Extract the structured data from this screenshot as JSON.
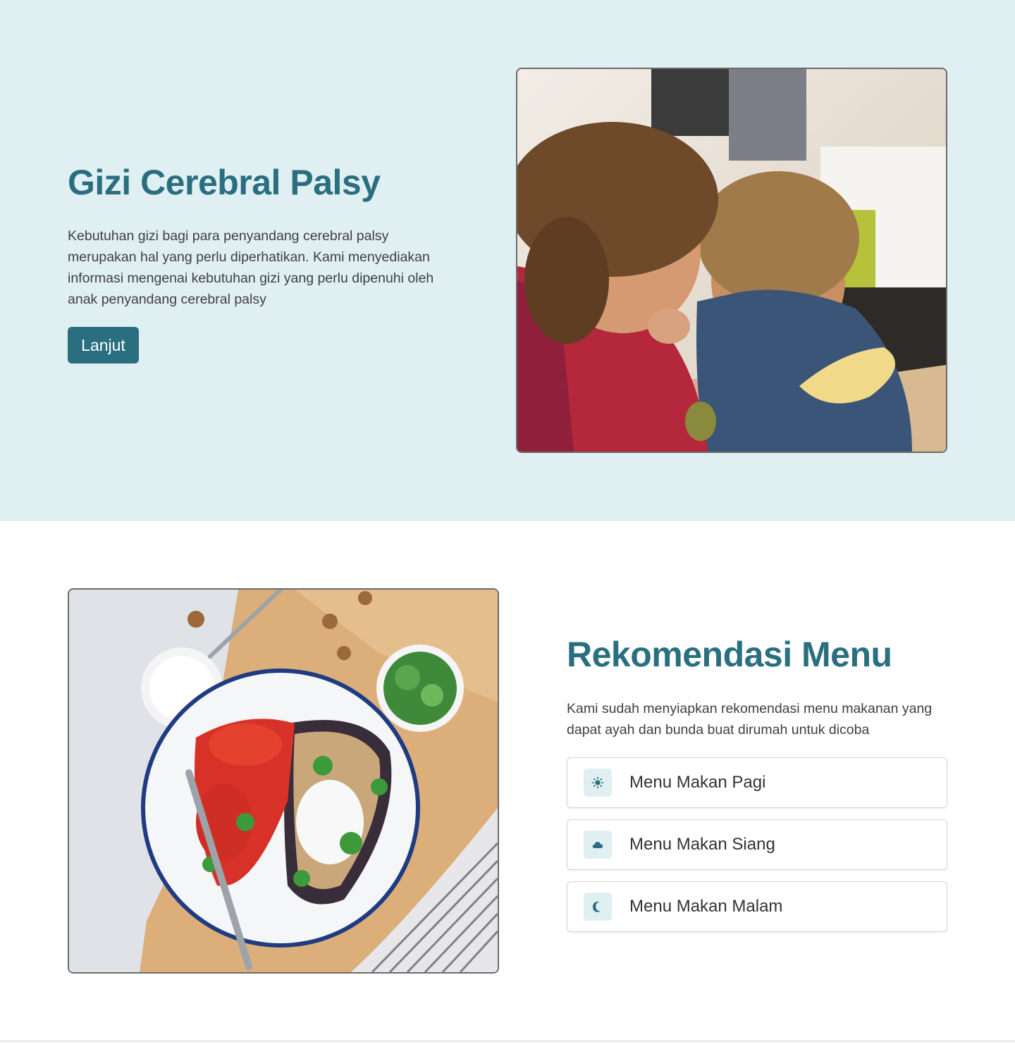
{
  "hero": {
    "title": "Gizi Cerebral Palsy",
    "description": "Kebutuhan gizi bagi para penyandang cerebral palsy merupakan hal yang perlu diperhatikan. Kami menyediakan informasi mengenai kebutuhan gizi yang perlu dipenuhi oleh anak penyandang cerebral palsy",
    "button_label": "Lanjut",
    "image": "children-eating-photo"
  },
  "menu": {
    "title": "Rekomendasi Menu",
    "description": "Kami sudah menyiapkan rekomendasi menu makanan yang dapat ayah dan bunda buat dirumah untuk dicoba",
    "image": "salad-plate-photo",
    "items": [
      {
        "label": "Menu Makan Pagi",
        "icon": "sun-icon"
      },
      {
        "label": "Menu Makan Siang",
        "icon": "cloud-icon"
      },
      {
        "label": "Menu Makan Malam",
        "icon": "moon-icon"
      }
    ]
  },
  "colors": {
    "accent": "#2a6f80",
    "hero_bg": "#e0eff2",
    "icon_bg": "#e0eff2"
  }
}
